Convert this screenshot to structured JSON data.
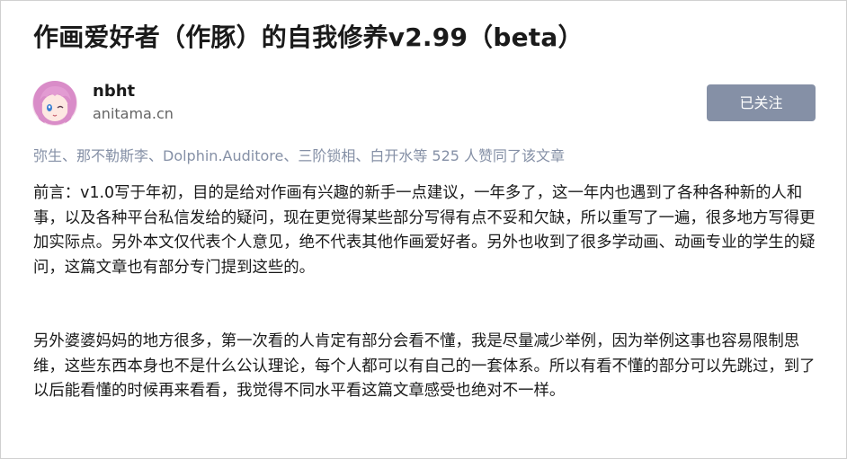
{
  "article": {
    "title": "作画爱好者（作豚）的自我修养v2.99（beta）",
    "paragraphs": [
      "前言：v1.0写于年初，目的是给对作画有兴趣的新手一点建议，一年多了，这一年内也遇到了各种各种新的人和事，以及各种平台私信发给的疑问，现在更觉得某些部分写得有点不妥和欠缺，所以重写了一遍，很多地方写得更加实际点。另外本文仅代表个人意见，绝不代表其他作画爱好者。另外也收到了很多学动画、动画专业的学生的疑问，这篇文章也有部分专门提到这些的。",
      "另外婆婆妈妈的地方很多，第一次看的人肯定有部分会看不懂，我是尽量减少举例，因为举例这事也容易限制思维，这些东西本身也不是什么公认理论，每个人都可以有自己的一套体系。所以有看不懂的部分可以先跳过，到了以后能看懂的时候再来看看，我觉得不同水平看这篇文章感受也绝对不一样。"
    ]
  },
  "author": {
    "name": "nbht",
    "site": "anitama.cn",
    "avatar_icon": "anime-girl-avatar"
  },
  "follow_button": {
    "label": "已关注"
  },
  "likes_line": "弥生、那不勒斯李、Dolphin.Auditore、三阶锁相、白开水等 525 人赞同了该文章",
  "colors": {
    "button_bg": "#8590a6",
    "muted_text": "#8590a6",
    "site_text": "#646464",
    "body_text": "#1a1a1a"
  }
}
